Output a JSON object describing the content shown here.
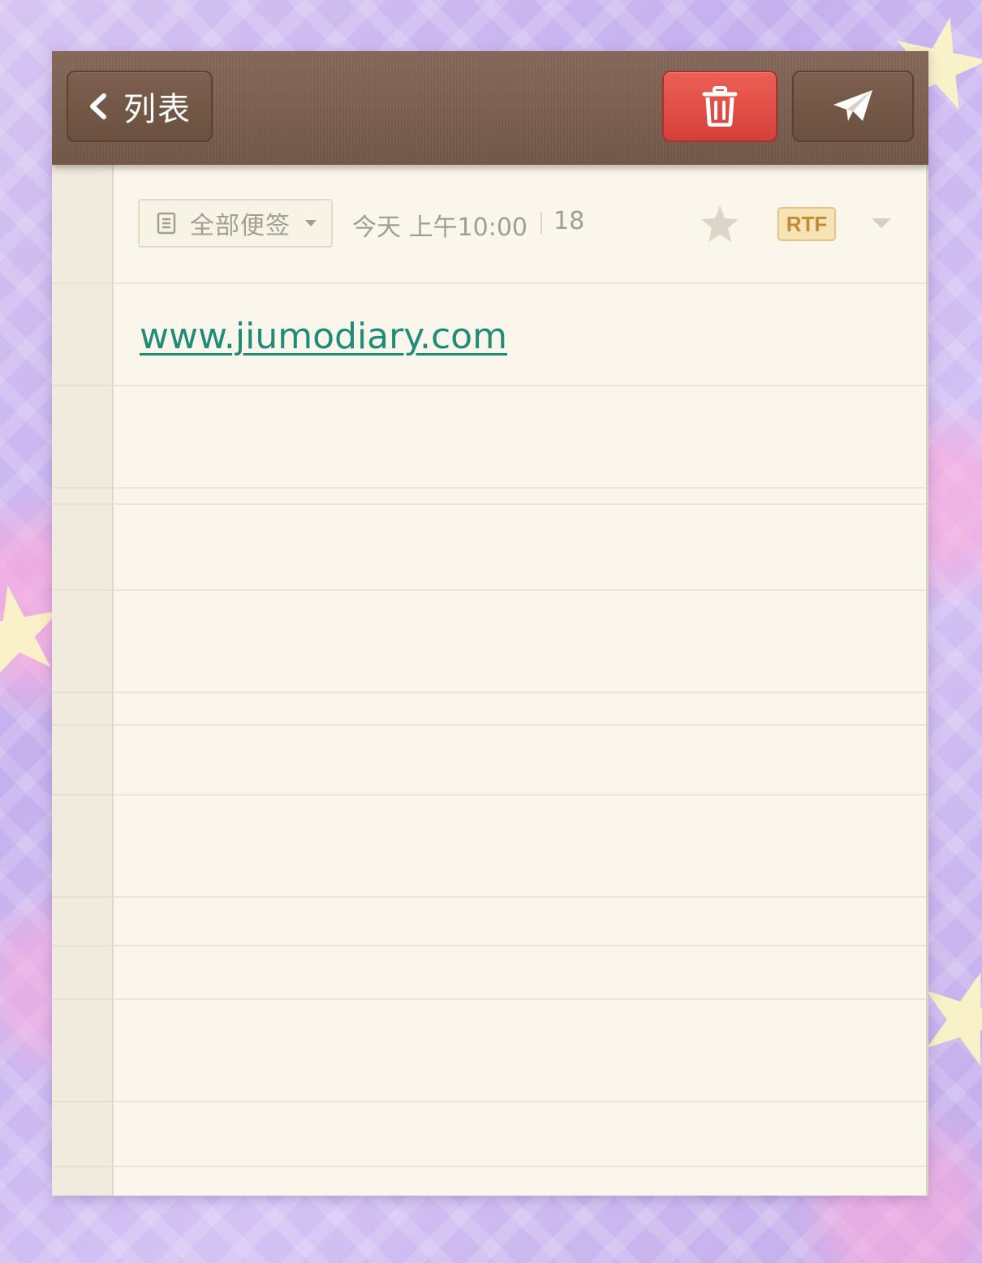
{
  "toolbar": {
    "back_label": "列表",
    "icons": {
      "back": "chevron-left-icon",
      "delete": "trash-icon",
      "share": "paper-plane-icon"
    }
  },
  "meta": {
    "notebook": "全部便签",
    "datetime": "今天 上午10:00",
    "char_count": "18",
    "format_badge": "RTF",
    "icons": {
      "notebook": "document-icon",
      "favorite": "star-icon",
      "more": "caret-down-icon"
    }
  },
  "note": {
    "content_link": "www.jiumodiary.com"
  },
  "colors": {
    "toolbar": "#7a5f50",
    "delete_button": "#e0483f",
    "paper": "#faf6ec",
    "link": "#1f8c77",
    "badge": "#f6e3b6"
  }
}
